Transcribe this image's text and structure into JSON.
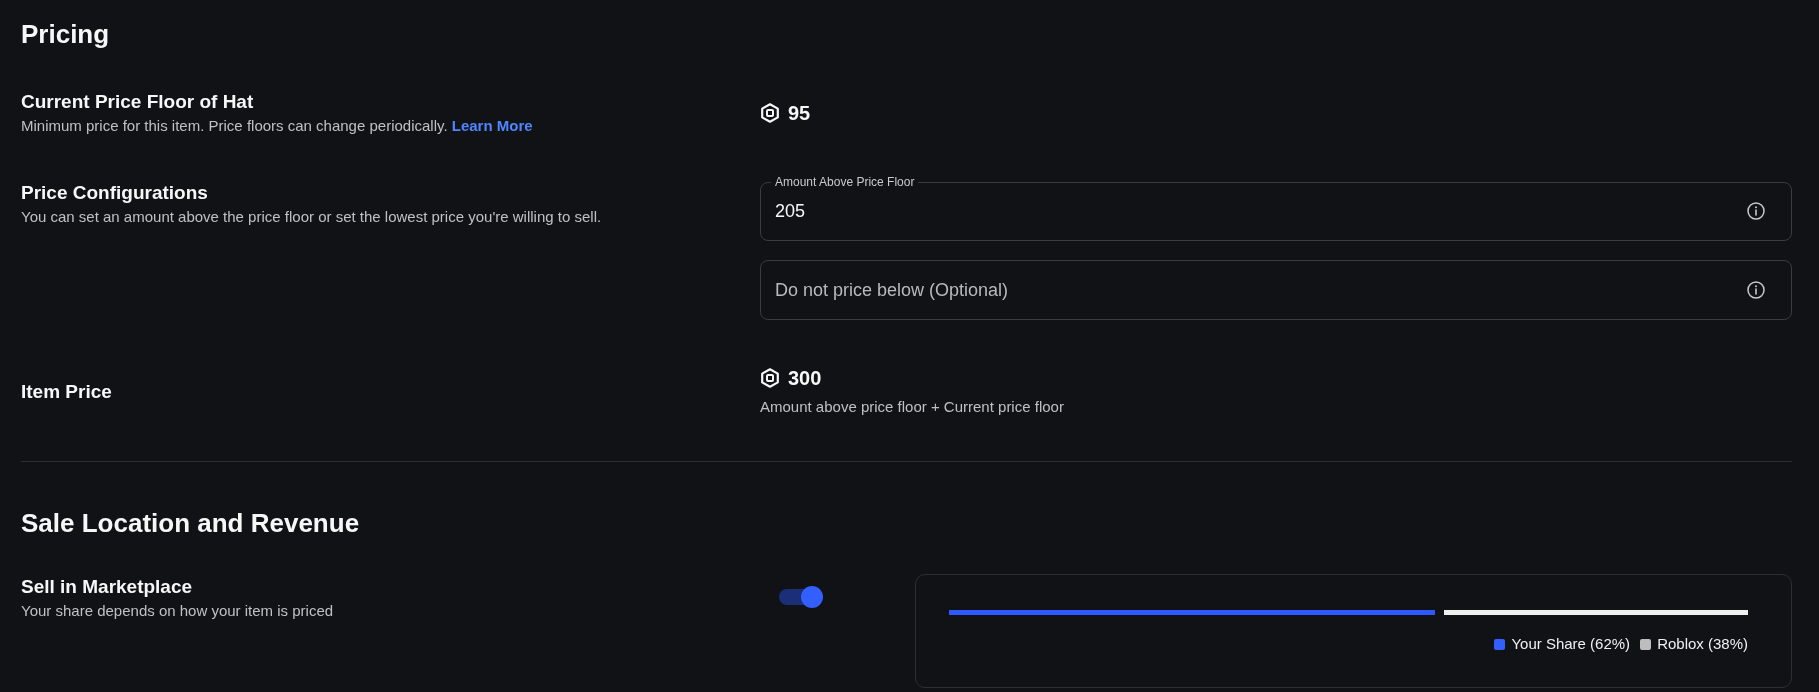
{
  "sections": [
    {
      "title": "Pricing",
      "rows": [
        {
          "kind": "price",
          "label": "Current Price Floor of Hat",
          "description": "Minimum price for this item. Price floors can change periodically.",
          "link": "Learn More",
          "value": "95"
        },
        {
          "kind": "fields",
          "label": "Price Configurations",
          "description": "You can set an amount above the price floor or set the lowest price you're willing to sell.",
          "fields": [
            {
              "label": "Amount Above Price Floor",
              "value": "205"
            },
            {
              "placeholder": "Do not price below (Optional)"
            }
          ]
        },
        {
          "kind": "price",
          "label": "Item Price",
          "value": "300",
          "note": "Amount above price floor + Current price floor"
        }
      ]
    },
    {
      "title": "Sale Location and Revenue",
      "rows": [
        {
          "kind": "toggle",
          "label": "Sell in Marketplace",
          "description": "Your share depends on how your item is priced",
          "on": true,
          "share_bar": {
            "level": 0.62
          },
          "legend": [
            {
              "label": "Your Share (62%)",
              "color": "#335fff"
            },
            {
              "label": "Roblox (38%)",
              "color": "#bdbdbd"
            }
          ]
        }
      ]
    }
  ]
}
